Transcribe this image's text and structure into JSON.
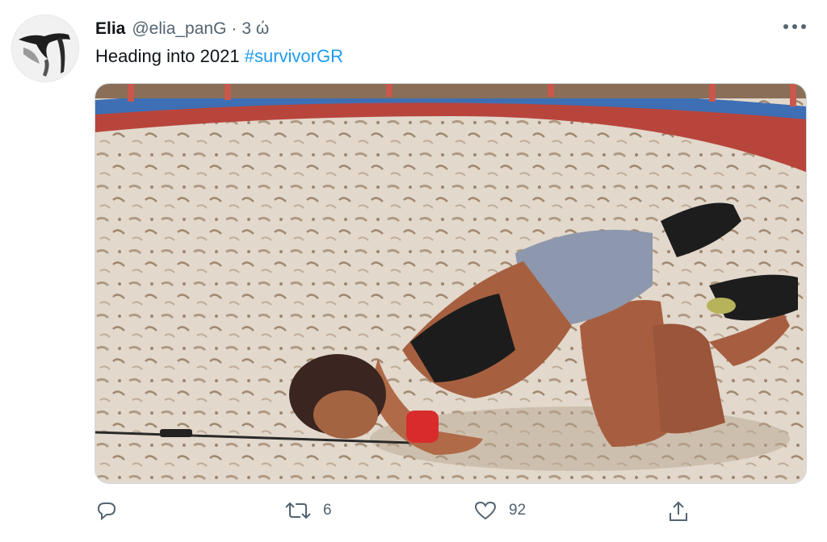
{
  "tweet": {
    "author_name": "Elia",
    "author_handle": "@elia_panG",
    "separator": "·",
    "timestamp": "3 ώ",
    "text": "Heading into 2021",
    "hashtag": "#survivorGR",
    "media_description": "photo"
  },
  "actions": {
    "reply_count": "",
    "retweet_count": "6",
    "like_count": "92",
    "share_count": ""
  },
  "icons": {
    "more": "more-horizontal-icon",
    "reply": "reply-icon",
    "retweet": "retweet-icon",
    "like": "heart-icon",
    "share": "share-icon"
  },
  "colors": {
    "text": "#0f1419",
    "secondary": "#536471",
    "link": "#1d9bf0",
    "border": "#cfd9de"
  }
}
